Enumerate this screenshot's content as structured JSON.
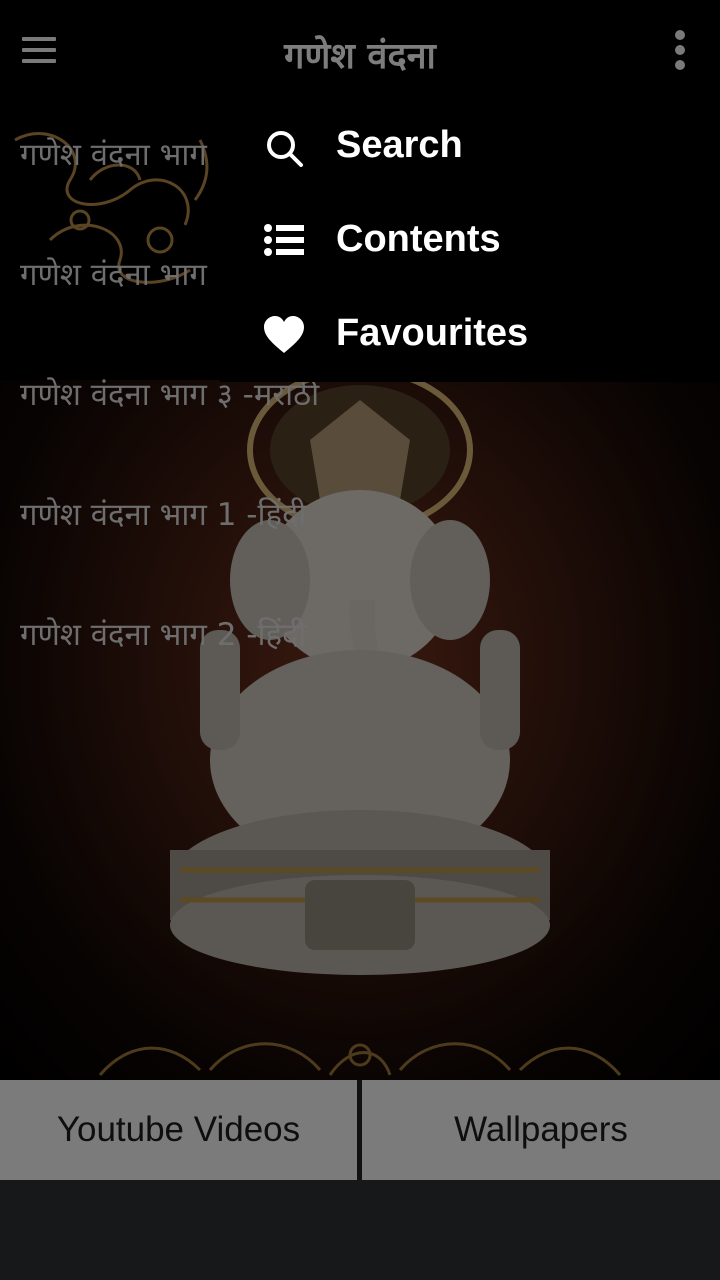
{
  "app": {
    "title": "गणेश वंदना"
  },
  "list": {
    "items": [
      {
        "label": "गणेश वंदना भाग"
      },
      {
        "label": "गणेश वंदना भाग"
      },
      {
        "label": "गणेश वंदना भाग ३ -मराठी"
      },
      {
        "label": "गणेश वंदना भाग 1 -हिंदी"
      },
      {
        "label": "गणेश वंदना  भाग 2 -हिंदी"
      }
    ]
  },
  "popup_menu": {
    "items": [
      {
        "label": "Search",
        "icon": "search-icon"
      },
      {
        "label": "Contents",
        "icon": "list-icon"
      },
      {
        "label": "Favourites",
        "icon": "heart-icon"
      }
    ]
  },
  "bottom_buttons": {
    "youtube": "Youtube Videos",
    "wallpapers": "Wallpapers"
  },
  "colors": {
    "popup_background": "#000000",
    "bottom_button": "#7b7b7b",
    "dim_text": "#6e6e6e"
  }
}
